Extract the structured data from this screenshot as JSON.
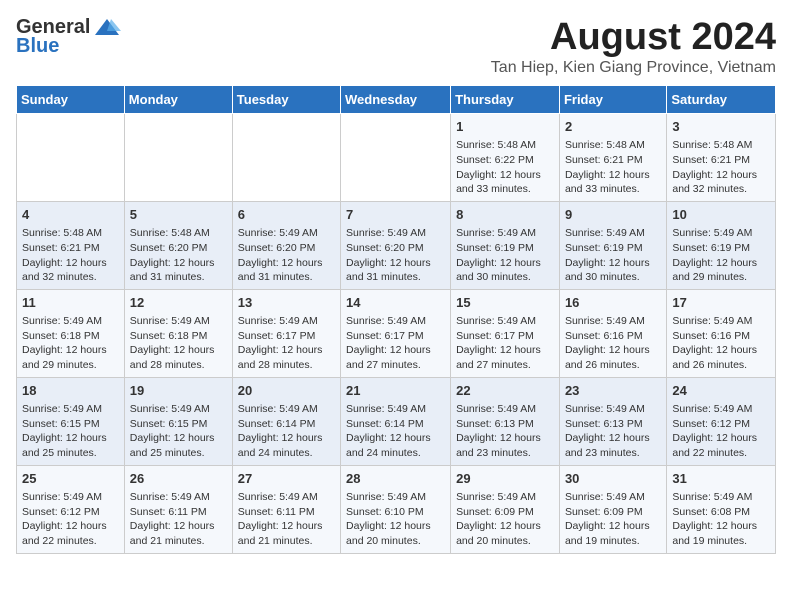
{
  "header": {
    "logo_general": "General",
    "logo_blue": "Blue",
    "month_title": "August 2024",
    "location": "Tan Hiep, Kien Giang Province, Vietnam"
  },
  "days_of_week": [
    "Sunday",
    "Monday",
    "Tuesday",
    "Wednesday",
    "Thursday",
    "Friday",
    "Saturday"
  ],
  "weeks": [
    [
      {
        "day": "",
        "info": ""
      },
      {
        "day": "",
        "info": ""
      },
      {
        "day": "",
        "info": ""
      },
      {
        "day": "",
        "info": ""
      },
      {
        "day": "1",
        "info": "Sunrise: 5:48 AM\nSunset: 6:22 PM\nDaylight: 12 hours\nand 33 minutes."
      },
      {
        "day": "2",
        "info": "Sunrise: 5:48 AM\nSunset: 6:21 PM\nDaylight: 12 hours\nand 33 minutes."
      },
      {
        "day": "3",
        "info": "Sunrise: 5:48 AM\nSunset: 6:21 PM\nDaylight: 12 hours\nand 32 minutes."
      }
    ],
    [
      {
        "day": "4",
        "info": "Sunrise: 5:48 AM\nSunset: 6:21 PM\nDaylight: 12 hours\nand 32 minutes."
      },
      {
        "day": "5",
        "info": "Sunrise: 5:48 AM\nSunset: 6:20 PM\nDaylight: 12 hours\nand 31 minutes."
      },
      {
        "day": "6",
        "info": "Sunrise: 5:49 AM\nSunset: 6:20 PM\nDaylight: 12 hours\nand 31 minutes."
      },
      {
        "day": "7",
        "info": "Sunrise: 5:49 AM\nSunset: 6:20 PM\nDaylight: 12 hours\nand 31 minutes."
      },
      {
        "day": "8",
        "info": "Sunrise: 5:49 AM\nSunset: 6:19 PM\nDaylight: 12 hours\nand 30 minutes."
      },
      {
        "day": "9",
        "info": "Sunrise: 5:49 AM\nSunset: 6:19 PM\nDaylight: 12 hours\nand 30 minutes."
      },
      {
        "day": "10",
        "info": "Sunrise: 5:49 AM\nSunset: 6:19 PM\nDaylight: 12 hours\nand 29 minutes."
      }
    ],
    [
      {
        "day": "11",
        "info": "Sunrise: 5:49 AM\nSunset: 6:18 PM\nDaylight: 12 hours\nand 29 minutes."
      },
      {
        "day": "12",
        "info": "Sunrise: 5:49 AM\nSunset: 6:18 PM\nDaylight: 12 hours\nand 28 minutes."
      },
      {
        "day": "13",
        "info": "Sunrise: 5:49 AM\nSunset: 6:17 PM\nDaylight: 12 hours\nand 28 minutes."
      },
      {
        "day": "14",
        "info": "Sunrise: 5:49 AM\nSunset: 6:17 PM\nDaylight: 12 hours\nand 27 minutes."
      },
      {
        "day": "15",
        "info": "Sunrise: 5:49 AM\nSunset: 6:17 PM\nDaylight: 12 hours\nand 27 minutes."
      },
      {
        "day": "16",
        "info": "Sunrise: 5:49 AM\nSunset: 6:16 PM\nDaylight: 12 hours\nand 26 minutes."
      },
      {
        "day": "17",
        "info": "Sunrise: 5:49 AM\nSunset: 6:16 PM\nDaylight: 12 hours\nand 26 minutes."
      }
    ],
    [
      {
        "day": "18",
        "info": "Sunrise: 5:49 AM\nSunset: 6:15 PM\nDaylight: 12 hours\nand 25 minutes."
      },
      {
        "day": "19",
        "info": "Sunrise: 5:49 AM\nSunset: 6:15 PM\nDaylight: 12 hours\nand 25 minutes."
      },
      {
        "day": "20",
        "info": "Sunrise: 5:49 AM\nSunset: 6:14 PM\nDaylight: 12 hours\nand 24 minutes."
      },
      {
        "day": "21",
        "info": "Sunrise: 5:49 AM\nSunset: 6:14 PM\nDaylight: 12 hours\nand 24 minutes."
      },
      {
        "day": "22",
        "info": "Sunrise: 5:49 AM\nSunset: 6:13 PM\nDaylight: 12 hours\nand 23 minutes."
      },
      {
        "day": "23",
        "info": "Sunrise: 5:49 AM\nSunset: 6:13 PM\nDaylight: 12 hours\nand 23 minutes."
      },
      {
        "day": "24",
        "info": "Sunrise: 5:49 AM\nSunset: 6:12 PM\nDaylight: 12 hours\nand 22 minutes."
      }
    ],
    [
      {
        "day": "25",
        "info": "Sunrise: 5:49 AM\nSunset: 6:12 PM\nDaylight: 12 hours\nand 22 minutes."
      },
      {
        "day": "26",
        "info": "Sunrise: 5:49 AM\nSunset: 6:11 PM\nDaylight: 12 hours\nand 21 minutes."
      },
      {
        "day": "27",
        "info": "Sunrise: 5:49 AM\nSunset: 6:11 PM\nDaylight: 12 hours\nand 21 minutes."
      },
      {
        "day": "28",
        "info": "Sunrise: 5:49 AM\nSunset: 6:10 PM\nDaylight: 12 hours\nand 20 minutes."
      },
      {
        "day": "29",
        "info": "Sunrise: 5:49 AM\nSunset: 6:09 PM\nDaylight: 12 hours\nand 20 minutes."
      },
      {
        "day": "30",
        "info": "Sunrise: 5:49 AM\nSunset: 6:09 PM\nDaylight: 12 hours\nand 19 minutes."
      },
      {
        "day": "31",
        "info": "Sunrise: 5:49 AM\nSunset: 6:08 PM\nDaylight: 12 hours\nand 19 minutes."
      }
    ]
  ]
}
